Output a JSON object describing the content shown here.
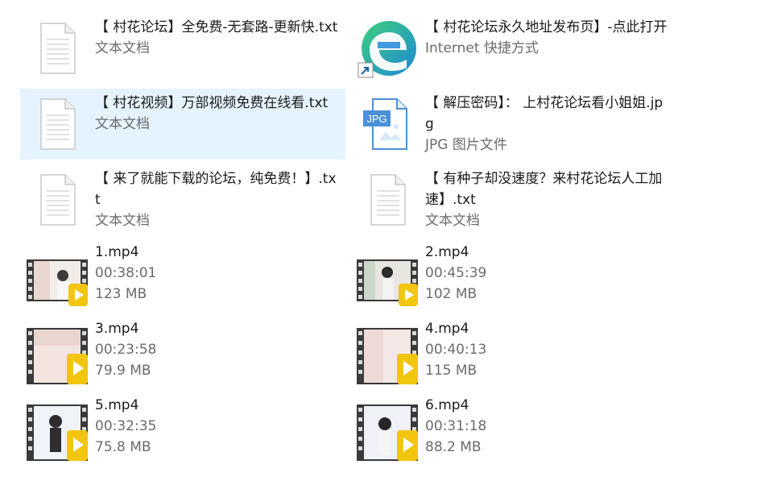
{
  "files": [
    {
      "name": "【 村花论坛】全免费-无套路-更新快.txt",
      "type": "文本文档",
      "icon": "text-document-icon"
    },
    {
      "name": "【 村花论坛永久地址发布页】-点此打开",
      "type": "Internet 快捷方式",
      "icon": "edge-shortcut-icon"
    },
    {
      "name": "【 村花视频】万部视频免费在线看.txt",
      "type": "文本文档",
      "icon": "text-document-icon",
      "selected": true
    },
    {
      "name": "【 解压密码】： 上村花论坛看小姐姐.jpg",
      "type": "JPG 图片文件",
      "icon": "jpg-file-icon",
      "badge": "JPG"
    },
    {
      "name": "【 来了就能下载的论坛，纯免费！】.txt",
      "type": "文本文档",
      "icon": "text-document-icon"
    },
    {
      "name": "【 有种子却没速度？来村花论坛人工加速】.txt",
      "type": "文本文档",
      "icon": "text-document-icon"
    }
  ],
  "videos": [
    {
      "name": "1.mp4",
      "duration": "00:38:01",
      "size": "123 MB"
    },
    {
      "name": "2.mp4",
      "duration": "00:45:39",
      "size": "102 MB"
    },
    {
      "name": "3.mp4",
      "duration": "00:23:58",
      "size": "79.9 MB"
    },
    {
      "name": "4.mp4",
      "duration": "00:40:13",
      "size": "115 MB"
    },
    {
      "name": "5.mp4",
      "duration": "00:32:35",
      "size": "75.8 MB"
    },
    {
      "name": "6.mp4",
      "duration": "00:31:18",
      "size": "88.2 MB"
    }
  ],
  "colors": {
    "selection": "#e5f3ff",
    "meta_text": "#6b6b6b",
    "play_badge": "#f2c50f",
    "edge_blue": "#1e88d8",
    "edge_green": "#3fcf7b"
  }
}
